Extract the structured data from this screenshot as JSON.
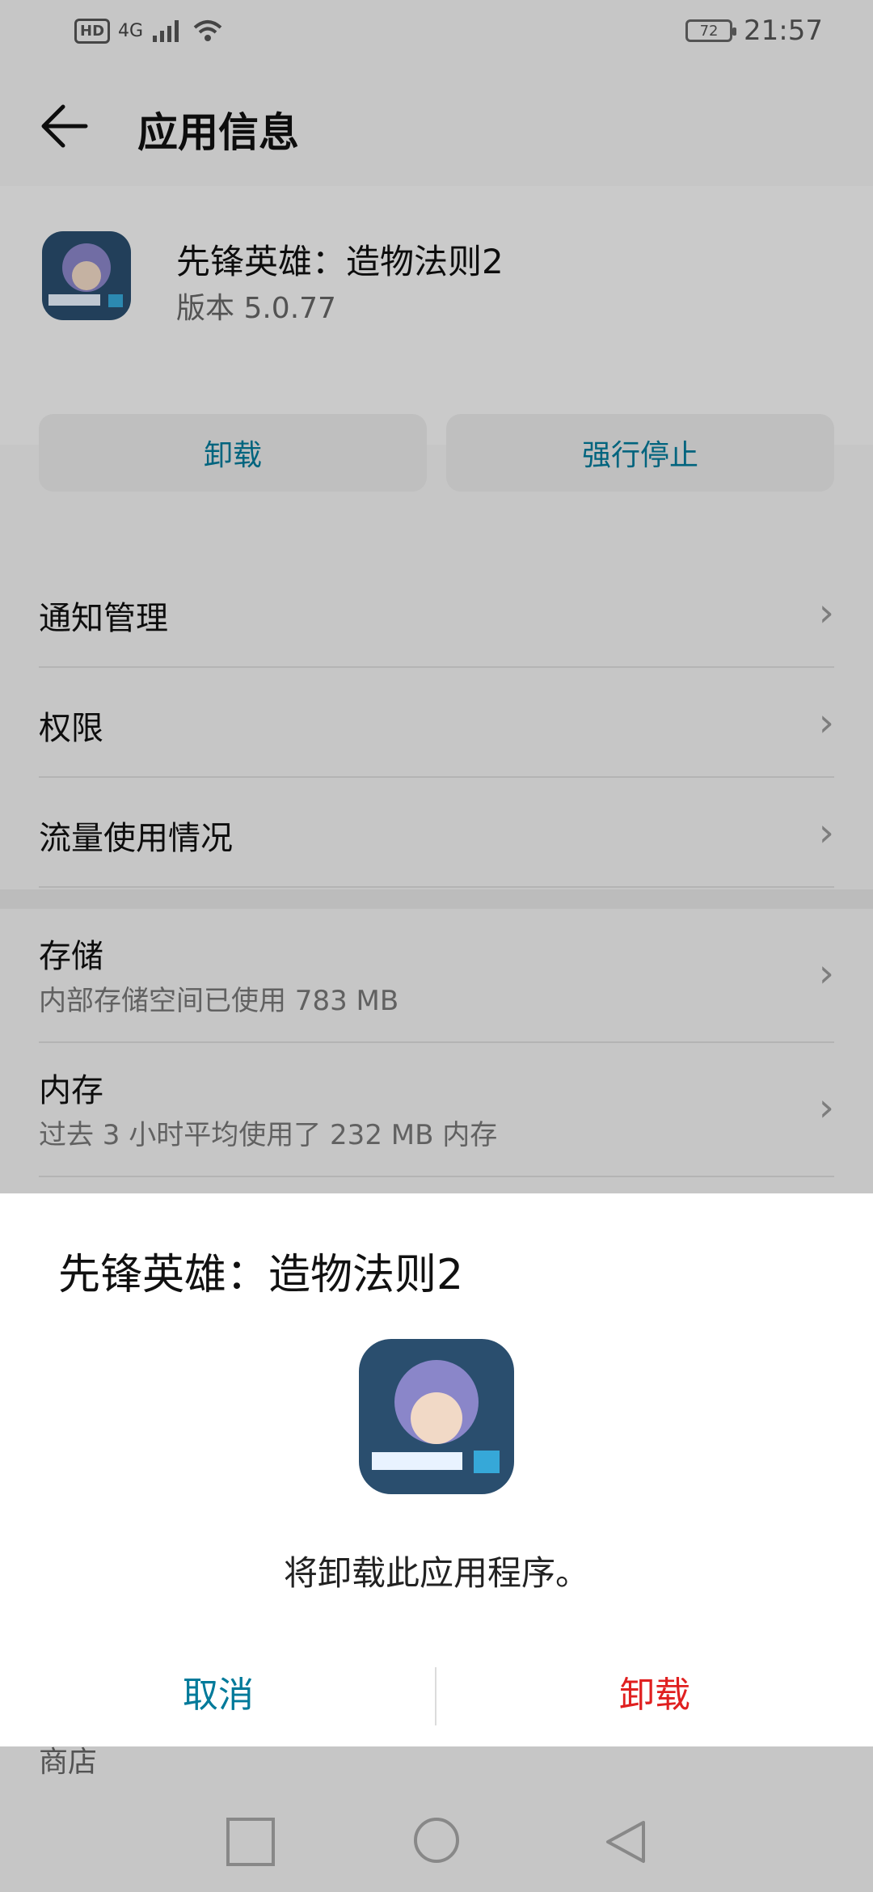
{
  "status_bar": {
    "network": "4G",
    "hd": "HD",
    "battery": "72",
    "time": "21:57"
  },
  "header": {
    "title": "应用信息"
  },
  "app": {
    "name": "先锋英雄：造物法则2",
    "version": "版本 5.0.77",
    "uninstall_label": "卸载",
    "force_stop_label": "强行停止"
  },
  "settings": {
    "items": [
      {
        "label": "通知管理"
      },
      {
        "label": "权限"
      },
      {
        "label": "流量使用情况"
      }
    ],
    "storage": {
      "label": "存储",
      "sub": "内部存储空间已使用 783 MB"
    },
    "memory": {
      "label": "内存",
      "sub": "过去 3 小时平均使用了 232 MB 内存"
    },
    "store_label": "商店"
  },
  "dialog": {
    "title": "先锋英雄：造物法则2",
    "message": "将卸载此应用程序。",
    "cancel_label": "取消",
    "uninstall_label": "卸载"
  },
  "colors": {
    "accent": "#007a9a",
    "danger": "#e02020"
  },
  "icons": {
    "back": "arrow-left-icon",
    "chevron": "chevron-right-icon"
  }
}
